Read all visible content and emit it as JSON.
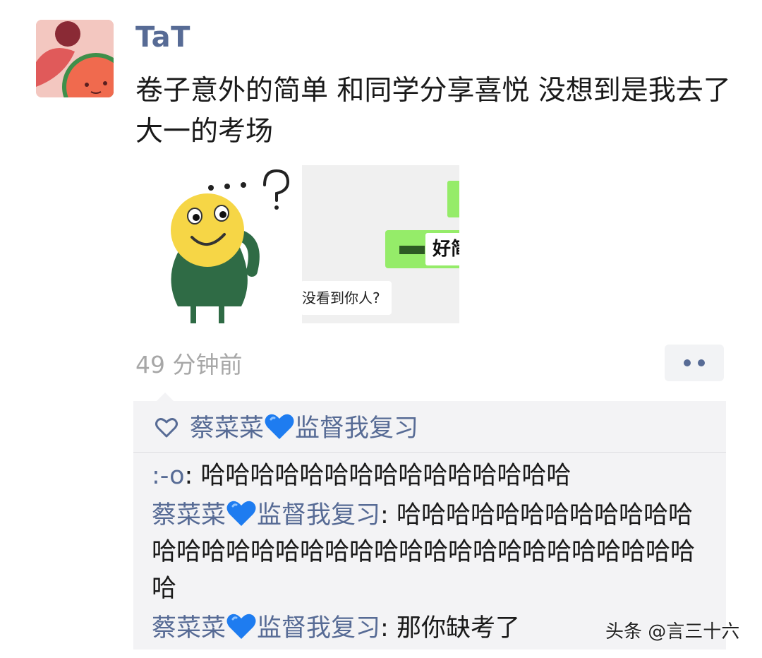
{
  "post": {
    "author": "TaT",
    "text": "卷子意外的简单 和同学分享喜悦 没想到是我去了大一的考场",
    "time": "49 分钟前"
  },
  "images": {
    "image1_name": "confused-emoji-sticker",
    "image2": {
      "reply_text": "好简",
      "incoming_text": "没看到你人?"
    }
  },
  "likes": {
    "names": [
      "蔡菜菜💙监督我复习"
    ],
    "name_part1": "蔡菜菜",
    "name_part2": "监督我复习"
  },
  "comments": [
    {
      "author": ":-o",
      "text": "哈哈哈哈哈哈哈哈哈哈哈哈哈哈哈"
    },
    {
      "author_part1": "蔡菜菜",
      "author_part2": "监督我复习",
      "text": "哈哈哈哈哈哈哈哈哈哈哈哈哈哈哈哈哈哈哈哈哈哈哈哈哈哈哈哈哈哈哈哈哈哈哈"
    },
    {
      "author_part1": "蔡菜菜",
      "author_part2": "监督我复习",
      "text": "那你缺考了"
    }
  ],
  "watermark": "头条 @言三十六",
  "colors": {
    "link": "#576b95",
    "heart": "#1e7cf0",
    "comment_bg": "#f3f3f5",
    "chat_green": "#95ec69"
  },
  "icons": {
    "like": "heart-outline-icon",
    "more": "more-dots-icon",
    "emoji": "blue-heart-emoji-icon"
  }
}
